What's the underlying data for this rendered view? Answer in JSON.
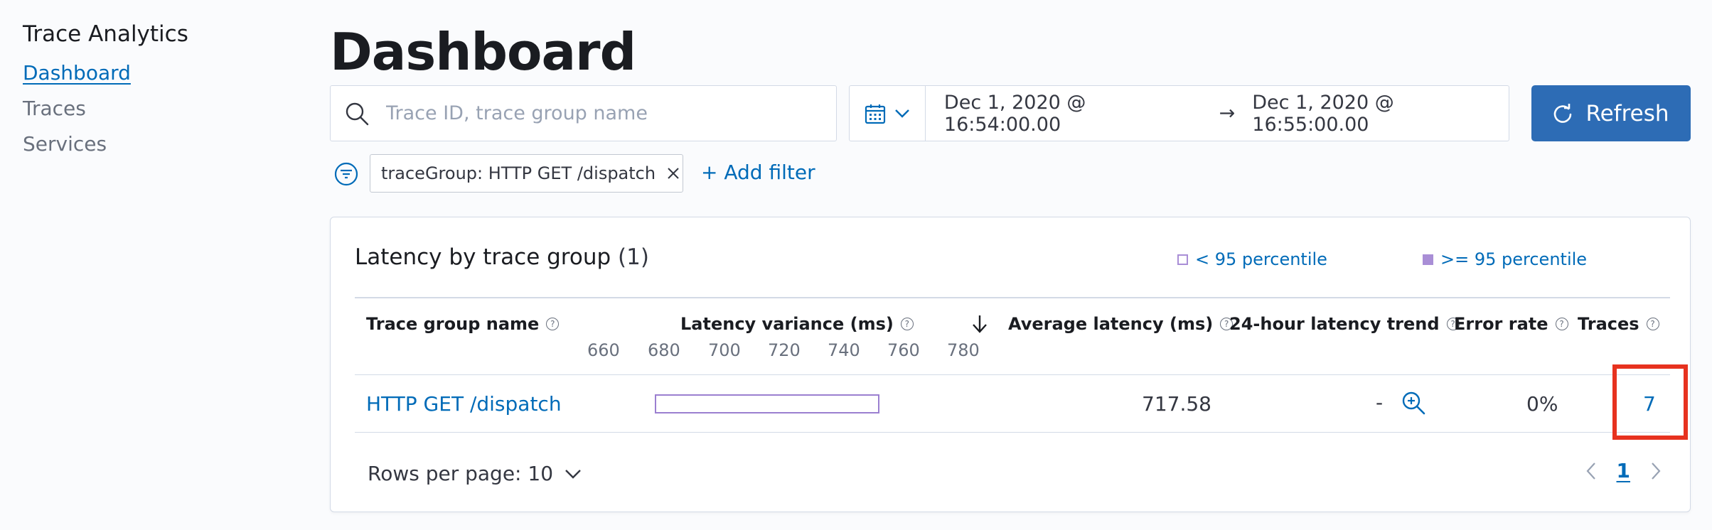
{
  "sidebar": {
    "title": "Trace Analytics",
    "items": [
      {
        "label": "Dashboard",
        "active": true
      },
      {
        "label": "Traces",
        "active": false
      },
      {
        "label": "Services",
        "active": false
      }
    ]
  },
  "page": {
    "title": "Dashboard"
  },
  "search": {
    "placeholder": "Trace ID, trace group name",
    "value": ""
  },
  "date_picker": {
    "start": "Dec 1, 2020 @ 16:54:00.00",
    "end": "Dec 1, 2020 @ 16:55:00.00",
    "arrow": "→"
  },
  "refresh_button": {
    "label": "Refresh"
  },
  "filters": {
    "pills": [
      {
        "label": "traceGroup: HTTP GET /dispatch"
      }
    ],
    "add_label": "+ Add filter"
  },
  "panel": {
    "title": "Latency by trace group",
    "count": "(1)",
    "legend": [
      {
        "label": "< 95 percentile",
        "filled": false
      },
      {
        "label": ">= 95 percentile",
        "filled": true
      }
    ],
    "columns": {
      "name": "Trace group name",
      "latency_variance": "Latency variance (ms)",
      "avg_latency": "Average latency (ms)",
      "trend": "24-hour latency trend",
      "error_rate": "Error rate",
      "traces": "Traces"
    },
    "axis_ticks": [
      "660",
      "680",
      "700",
      "720",
      "740",
      "760",
      "780"
    ],
    "rows": [
      {
        "name": "HTTP GET /dispatch",
        "avg_latency": "717.58",
        "trend": "-",
        "error_rate": "0%",
        "traces": "7"
      }
    ],
    "rows_per_page": "Rows per page: 10",
    "current_page": "1"
  },
  "colors": {
    "accent": "#006bb8",
    "refresh_bg": "#2d6cb5",
    "percentile_purple": "#a98ed6",
    "highlight": "#e7321f"
  }
}
